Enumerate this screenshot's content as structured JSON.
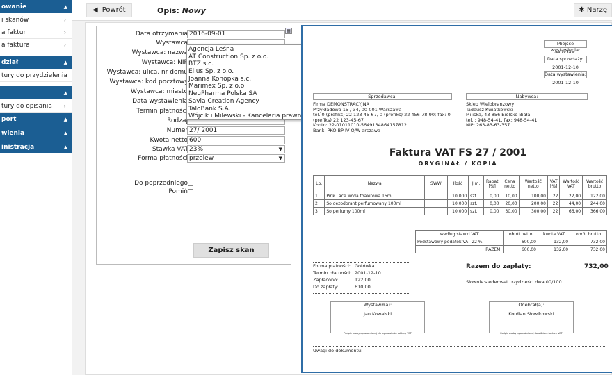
{
  "sidebar": {
    "sections": [
      {
        "title": "owanie",
        "items": [
          "i skanów",
          "a faktur",
          "a faktura"
        ]
      },
      {
        "title": "dział",
        "items": [
          "tury do przydzielenia"
        ]
      },
      {
        "title": "",
        "items": [
          "tury do opisania"
        ]
      },
      {
        "title": "port",
        "items": []
      },
      {
        "title": "wienia",
        "items": []
      },
      {
        "title": "inistracja",
        "items": []
      }
    ]
  },
  "topbar": {
    "back_label": "Powrót",
    "title_prefix": "Opis:",
    "title_value": "Nowy",
    "tools_label": "Narzę"
  },
  "form": {
    "fields": [
      {
        "label": "Data otrzymania:",
        "value": "2016-09-01",
        "type": "text"
      },
      {
        "label": "Wystawca:",
        "value": "",
        "type": "text"
      },
      {
        "label": "Wystawca: nazwa:",
        "value": "",
        "type": "text"
      },
      {
        "label": "Wystawca: NIP:",
        "value": "",
        "type": "text"
      },
      {
        "label": "Wystawca: ulica, nr domu:",
        "value": "",
        "type": "text"
      },
      {
        "label": "Wystawca: kod pocztowy:",
        "value": "",
        "type": "text"
      },
      {
        "label": "Wystawca: miasto:",
        "value": "",
        "type": "text"
      },
      {
        "label": "Data wystawienia:",
        "value": "",
        "type": "text"
      },
      {
        "label": "Termin płatności:",
        "value": "",
        "type": "text"
      },
      {
        "label": "Rodzaj:",
        "value": "",
        "type": "text"
      },
      {
        "label": "Numer:",
        "value": "27/ 2001",
        "type": "text"
      },
      {
        "label": "Kwota netto:",
        "value": "600",
        "type": "text"
      },
      {
        "label": "Stawka VAT:",
        "value": "23%",
        "type": "select"
      },
      {
        "label": "Forma płatności:",
        "value": "przelew",
        "type": "select"
      }
    ],
    "checkboxes": [
      {
        "label": "Do poprzedniego:"
      },
      {
        "label": "Pomiń:"
      }
    ],
    "save_label": "Zapisz skan",
    "dropdown": [
      "Agencja Leśna",
      "AT Construction Sp. z o.o.",
      "BTZ s.c.",
      "Elius Sp. z o.o.",
      "Joanna Konopka s.c.",
      "Marimex Sp. z o.o.",
      "NeuPharma Polska SA",
      "Savia Creation Agency",
      "TaloBank S.A.",
      "Wójcik i Milewski - Kancelaria prawnicza"
    ]
  },
  "invoice": {
    "place_label": "Miejsce wystawienia:",
    "place": "Wrocław",
    "sale_label": "Data sprzedaży:",
    "sale": "2001-12-10",
    "issue_label": "Data wystawienia:",
    "issue": "2001-12-10",
    "seller_label": "Sprzedawca:",
    "seller": [
      "Firma DEMONSTRACYJNA",
      "Przykładowa 15 / 34, 00-001 Warszawa",
      "tel. 0 (prefiks) 22 123-45-67, 0 (prefiks) 22 456-78-90;  fax: 0",
      "(prefiks) 22 123-45-67",
      "Konto: 22-01011010-5649134864157812",
      "Bank: PKO BP IV O/W arszawa"
    ],
    "buyer_label": "Nabywca:",
    "buyer": [
      "Sklep Wielobranżowy",
      "Tadeusz Kwiatkowski",
      "Miliska, 43-856 Bielsko Biała",
      "tel. : 948-54-41,  fax: 948-54-41",
      "NIP: 263-83-63-357"
    ],
    "title": "Faktura VAT FS 27 / 2001",
    "subtitle": "ORYGINAŁ / KOPIA",
    "columns": [
      "Lp.",
      "Nazwa",
      "SWW",
      "Ilość",
      "J.m.",
      "Rabat [%]",
      "Cena netto",
      "Wartość netto",
      "VAT [%]",
      "Wartość VAT",
      "Wartość brutto"
    ],
    "rows": [
      [
        "1",
        "Pink Lace woda toaletowa 15ml",
        "",
        "10,000",
        "szt.",
        "0,00",
        "10,00",
        "100,00",
        "22",
        "22,00",
        "122,00"
      ],
      [
        "2",
        "So dezodorant perfumowany 100ml",
        "",
        "10,000",
        "szt.",
        "0,00",
        "20,00",
        "200,00",
        "22",
        "44,00",
        "244,00"
      ],
      [
        "3",
        "So perfumy 100ml",
        "",
        "10,000",
        "szt.",
        "0,00",
        "30,00",
        "300,00",
        "22",
        "66,00",
        "366,00"
      ]
    ],
    "vat_headers": [
      "według stawki VAT",
      "obrót netto",
      "kwota VAT",
      "obrót brutto"
    ],
    "vat_rows": [
      [
        "Podstawowy podatek VAT 22 %",
        "600,00",
        "132,00",
        "732,00"
      ],
      [
        "RAZEM:",
        "600,00",
        "132,00",
        "732,00"
      ]
    ],
    "pay_labels": [
      "Forma płatności:",
      "Termin płatności:",
      "Zapłacono:",
      "Do zapłaty:"
    ],
    "pay_values": [
      "Gotówka",
      "2001-12-10",
      "122,00",
      "610,00"
    ],
    "total_label": "Razem do zapłaty:",
    "total_value": "732,00",
    "words_label": "Słownie:",
    "words": "siedemset trzydzieści dwa 00/100",
    "issued_by_label": "Wystawił(a):",
    "issued_by": "Jan Kowalski",
    "received_by_label": "Odebrał(a):",
    "received_by": "Kordian Słowikowski",
    "sig_note_left": "Podpis osoby upoważnionej do wystawienia faktury VAT",
    "sig_note_right": "Podpis osoby upoważnionej do odbioru faktury VAT",
    "notes_label": "Uwagi do dokumentu:"
  },
  "colors": {
    "sidebar_header": "#1b5e93",
    "preview_border": "#2f6da6"
  }
}
